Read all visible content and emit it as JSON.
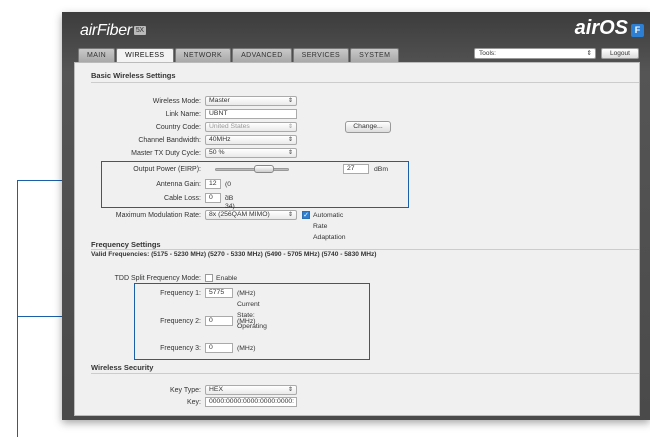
{
  "header": {
    "brand": "airFiber",
    "brand_badge": "5X",
    "os_logo": "airOS",
    "os_badge": "F",
    "tools_label": "Tools:",
    "logout_label": "Logout"
  },
  "tabs": [
    {
      "label": "MAIN"
    },
    {
      "label": "WIRELESS",
      "active": true
    },
    {
      "label": "NETWORK"
    },
    {
      "label": "ADVANCED"
    },
    {
      "label": "SERVICES"
    },
    {
      "label": "SYSTEM"
    }
  ],
  "basic": {
    "title": "Basic Wireless Settings",
    "wireless_mode_label": "Wireless Mode:",
    "wireless_mode_value": "Master",
    "link_name_label": "Link Name:",
    "link_name_value": "UBNT",
    "country_code_label": "Country Code:",
    "country_code_value": "United States",
    "change_button": "Change...",
    "channel_bandwidth_label": "Channel Bandwidth:",
    "channel_bandwidth_value": "40MHz",
    "duty_cycle_label": "Master TX Duty Cycle:",
    "duty_cycle_value": "50 %",
    "output_power_label": "Output Power (EIRP):",
    "output_power_value": "27",
    "output_power_unit": "dBm",
    "output_power_slider_fraction": 0.72,
    "antenna_gain_label": "Antenna Gain:",
    "antenna_gain_value": "12",
    "antenna_gain_hint": "(0 - 34) dBi",
    "cable_loss_label": "Cable Loss:",
    "cable_loss_value": "0",
    "cable_loss_unit": "dB",
    "max_mod_label": "Maximum Modulation Rate:",
    "max_mod_value": "8x (256QAM MIMO)",
    "auto_rate_label": "Automatic Rate Adaptation",
    "auto_rate_checked": true
  },
  "frequency": {
    "title": "Frequency Settings",
    "valid_frequencies": "Valid Frequencies: (5175 - 5230 MHz) (5270 - 5330 MHz) (5490 - 5705 MHz) (5740 - 5830 MHz)",
    "tdd_label": "TDD Split Frequency Mode:",
    "tdd_enable_label": "Enable",
    "freq1_label": "Frequency 1:",
    "freq1_value": "5775",
    "freq1_hint": "(MHz) Current State: Operating",
    "freq2_label": "Frequency 2:",
    "freq2_value": "0",
    "freq2_hint": "(MHz)",
    "freq3_label": "Frequency 3:",
    "freq3_value": "0",
    "freq3_hint": "(MHz)"
  },
  "security": {
    "title": "Wireless Security",
    "key_type_label": "Key Type:",
    "key_type_value": "HEX",
    "key_label": "Key:",
    "key_value": "0000:0000:0000:0000:0000:"
  },
  "colors": {
    "accent": "#1a5fa8",
    "header_bg": "#4a4a4a",
    "panel_bg": "#f0f0f0"
  }
}
